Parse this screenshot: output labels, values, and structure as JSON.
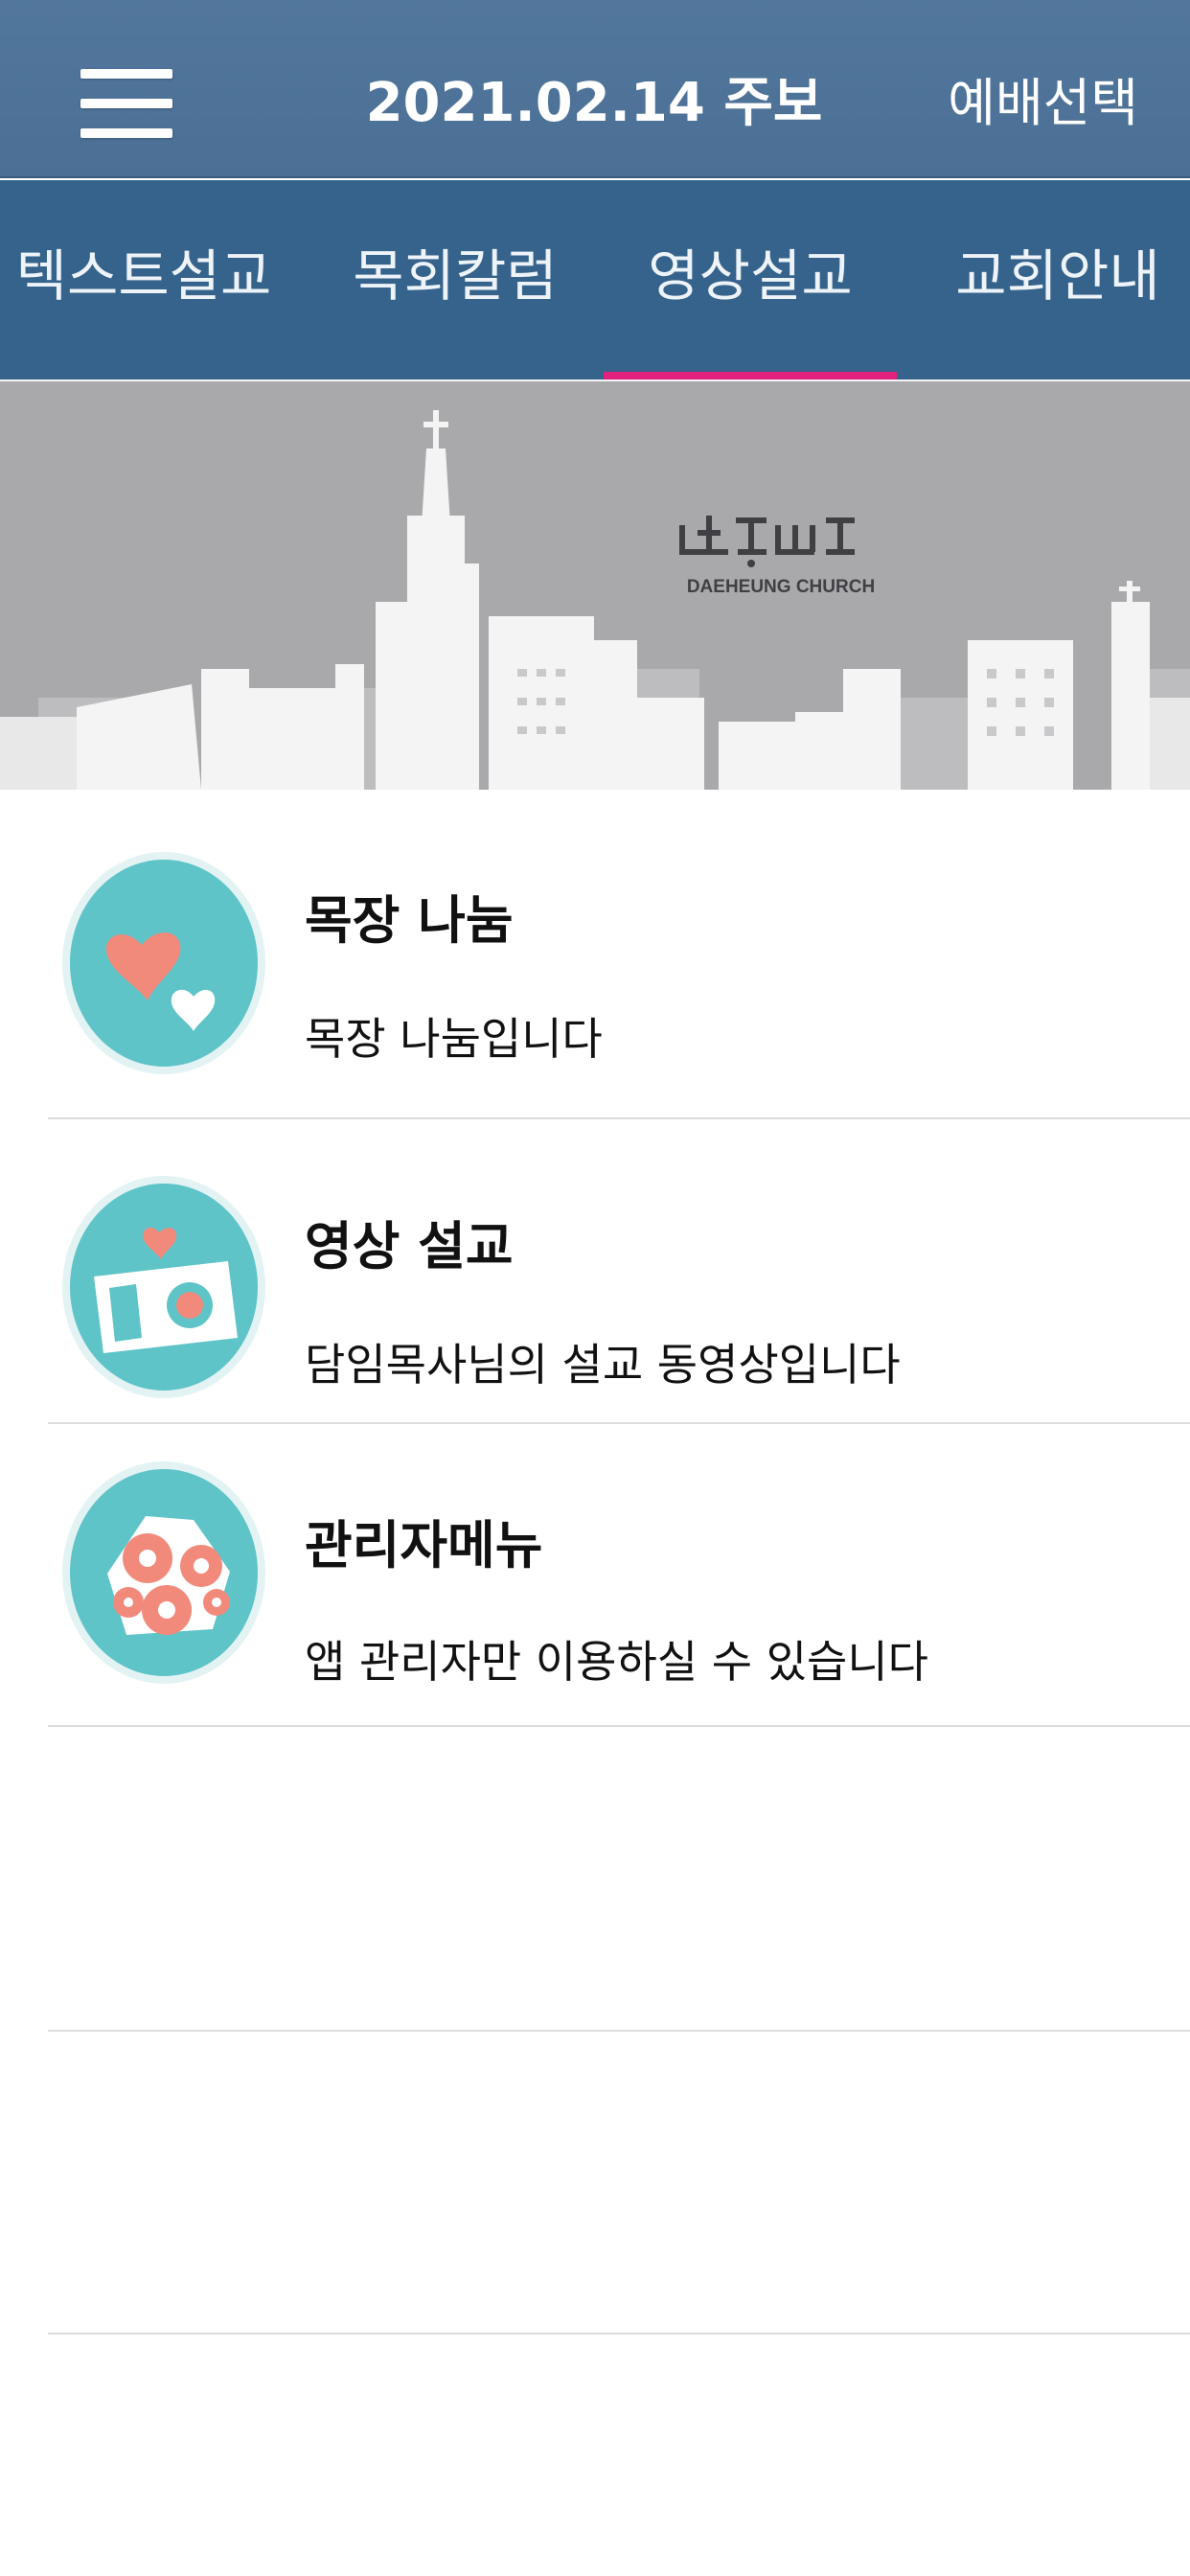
{
  "header": {
    "title": "2021.02.14 주보",
    "action_label": "예배선택"
  },
  "tabs": [
    {
      "label": "텍스트설교",
      "active": false
    },
    {
      "label": "목회칼럼",
      "active": false
    },
    {
      "label": "영상설교",
      "active": true
    },
    {
      "label": "교회안내",
      "active": false
    }
  ],
  "banner": {
    "logo_text": "DAEHEUNG CHURCH"
  },
  "menu": [
    {
      "title": "목장 나눔",
      "description": "목장 나눔입니다",
      "icon": "hearts-icon"
    },
    {
      "title": "영상 설교",
      "description": "담임목사님의 설교 동영상입니다",
      "icon": "camera-icon"
    },
    {
      "title": "관리자메뉴",
      "description": "앱 관리자만 이용하실 수 있습니다",
      "icon": "flowers-icon"
    }
  ],
  "colors": {
    "header_bg": "#4b6f95",
    "tab_bg": "#36638c",
    "tab_indicator": "#e0217e",
    "icon_teal": "#5ec4c8",
    "icon_coral": "#f28a7c",
    "banner_bg": "#a9a8ab"
  }
}
